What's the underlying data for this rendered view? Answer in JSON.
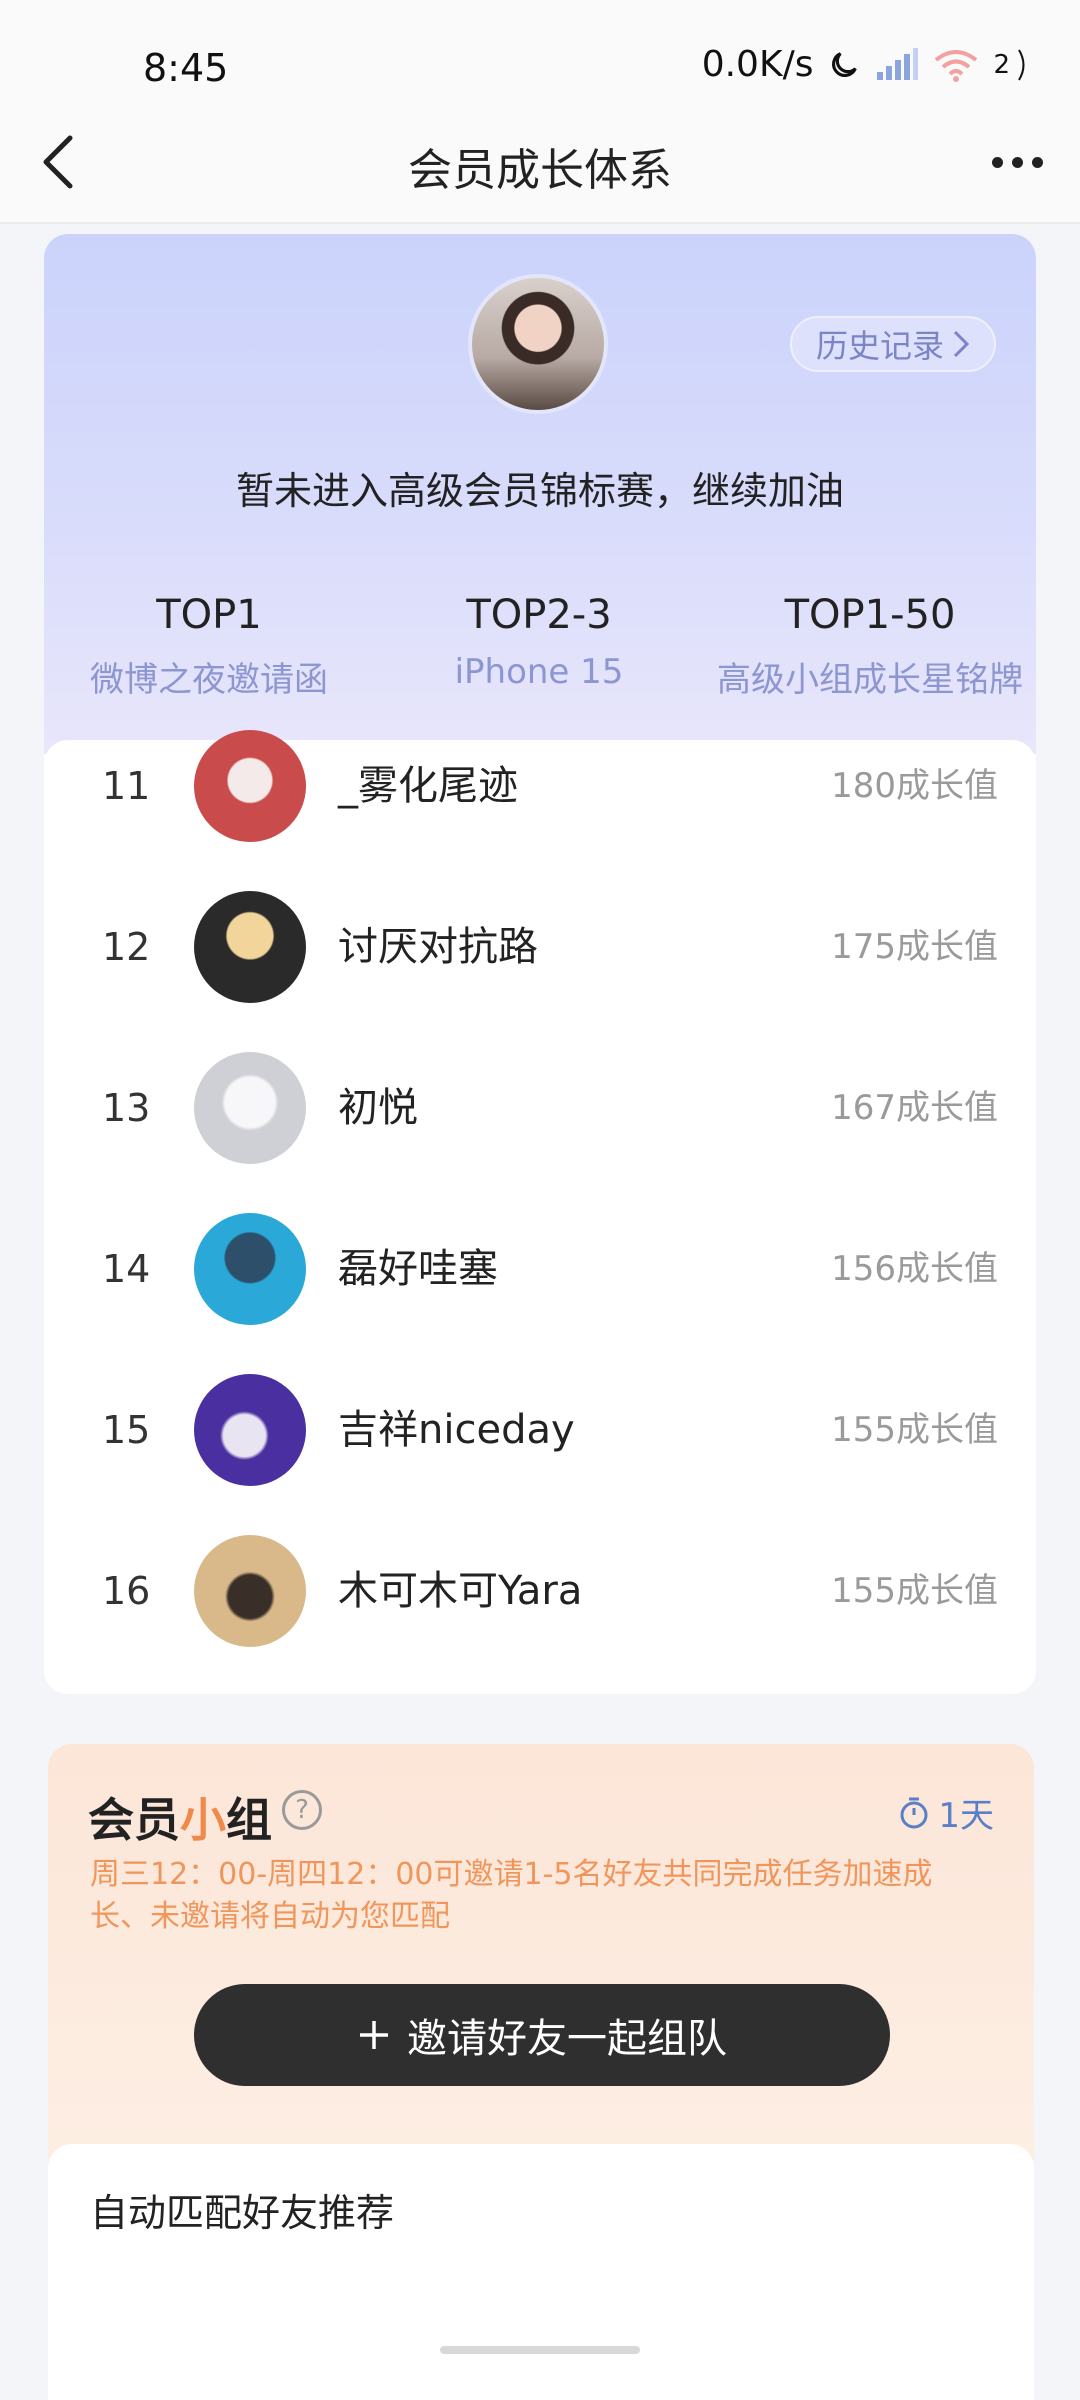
{
  "status_bar": {
    "time": "8:45",
    "network_speed": "0.0K/s",
    "battery_label": "2"
  },
  "nav": {
    "title": "会员成长体系",
    "back_icon": "chevron-left-icon",
    "more_icon": "more-dots-icon"
  },
  "ranking": {
    "history_label": "历史记录",
    "subtitle": "暂未进入高级会员锦标赛，继续加油",
    "prizes": [
      {
        "title": "TOP1",
        "desc": "微博之夜邀请函"
      },
      {
        "title": "TOP2-3",
        "desc": "iPhone 15"
      },
      {
        "title": "TOP1-50",
        "desc": "高级小组成长星铭牌"
      }
    ],
    "rows": [
      {
        "rank": "11",
        "name": "_雾化尾迹",
        "score": "180成长值",
        "avatar_color": "#c94b4b"
      },
      {
        "rank": "12",
        "name": "讨厌对抗路",
        "score": "175成长值",
        "avatar_color": "#2a2a2a"
      },
      {
        "rank": "13",
        "name": "初悦",
        "score": "167成长值",
        "avatar_color": "#cfcfd6"
      },
      {
        "rank": "14",
        "name": "磊好哇塞",
        "score": "156成长值",
        "avatar_color": "#2aa8d8"
      },
      {
        "rank": "15",
        "name": "吉祥niceday",
        "score": "155成长值",
        "avatar_color": "#4a2fa0"
      },
      {
        "rank": "16",
        "name": "木可木可Yara",
        "score": "155成长值",
        "avatar_color": "#b88a5a"
      }
    ]
  },
  "team": {
    "title_part1": "会员",
    "title_accent": "小",
    "title_part2": "组",
    "timer": "1天",
    "description": "周三12：00-周四12：00可邀请1-5名好友共同完成任务加速成长、未邀请将自动为您匹配",
    "invite_label": "邀请好友一起组队",
    "recommend_title": "自动匹配好友推荐"
  }
}
